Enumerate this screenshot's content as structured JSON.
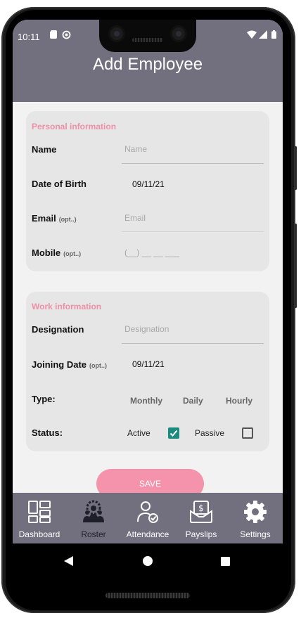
{
  "status_bar": {
    "time": "10:11"
  },
  "header": {
    "title": "Add Employee"
  },
  "personal": {
    "section_title": "Personal information",
    "name_label": "Name",
    "name_placeholder": "Name",
    "dob_label": "Date of Birth",
    "dob_value": "09/11/21",
    "email_label": "Email",
    "email_opt": "(opt..)",
    "email_placeholder": "Email",
    "mobile_label": "Mobile",
    "mobile_opt": "(opt..)",
    "mobile_placeholder": "(__) __ __ ___"
  },
  "work": {
    "section_title": "Work information",
    "designation_label": "Designation",
    "designation_placeholder": "Designation",
    "joining_label": "Joining Date",
    "joining_opt": "(opt..)",
    "joining_value": "09/11/21",
    "type_label": "Type:",
    "type_options": [
      "Monthly",
      "Daily",
      "Hourly"
    ],
    "status_label": "Status:",
    "active_label": "Active",
    "active_checked": true,
    "passive_label": "Passive",
    "passive_checked": false
  },
  "save_label": "SAVE",
  "tabs": [
    {
      "label": "Dashboard",
      "icon": "dashboard-icon",
      "active": false
    },
    {
      "label": "Roster",
      "icon": "roster-icon",
      "active": true
    },
    {
      "label": "Attendance",
      "icon": "attendance-icon",
      "active": false
    },
    {
      "label": "Payslips",
      "icon": "payslips-icon",
      "active": false
    },
    {
      "label": "Settings",
      "icon": "settings-icon",
      "active": false
    }
  ],
  "colors": {
    "header": "#72707f",
    "accent_pink": "#f593ad",
    "section_title": "#ef8fa6",
    "checkbox_checked": "#1d8a7f"
  }
}
